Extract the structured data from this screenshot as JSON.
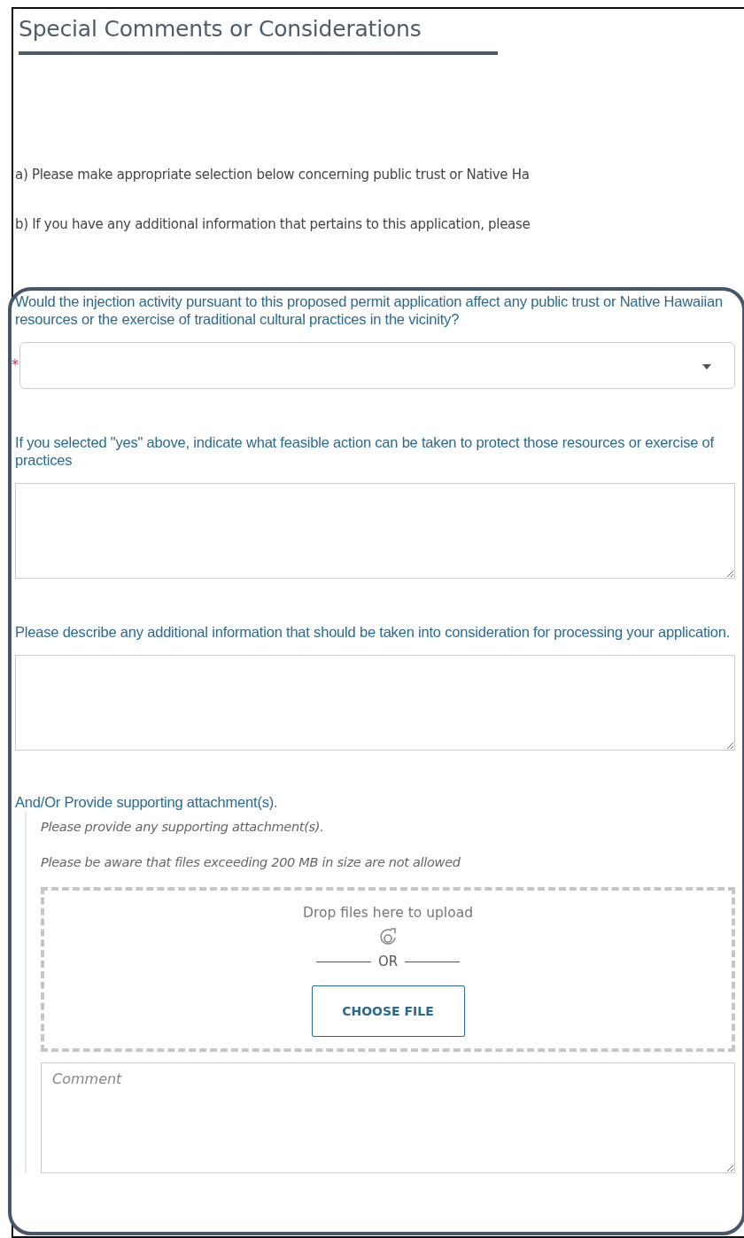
{
  "section": {
    "title": "Special Comments or Considerations",
    "instructions": [
      "a) Please make appropriate selection below concerning public trust or Native Ha",
      "b) If you have any additional information that pertains to this application, please"
    ]
  },
  "questions": [
    {
      "kind": "select",
      "label": "Would the injection activity pursuant to this proposed permit application affect any public trust or Native Hawaiian resources or the exercise of traditional cultural practices in the vicinity?",
      "required_mark": "*"
    },
    {
      "kind": "textarea",
      "label": "If you selected \"yes\" above, indicate what feasible action can be taken to protect those resources or exercise of practices"
    },
    {
      "kind": "textarea",
      "label": "Please describe any additional information that should be taken into consideration for processing your application."
    }
  ],
  "attachments": {
    "label": "And/Or Provide supporting attachment(s).",
    "hints": [
      "Please provide any supporting attachment(s).",
      "Please be aware that files exceeding 200 MB in size are not allowed"
    ],
    "drop_text": "Drop files here to upload",
    "or_text": "OR",
    "button": "CHOOSE FILE",
    "comment": {
      "placeholder": "Comment"
    }
  }
}
